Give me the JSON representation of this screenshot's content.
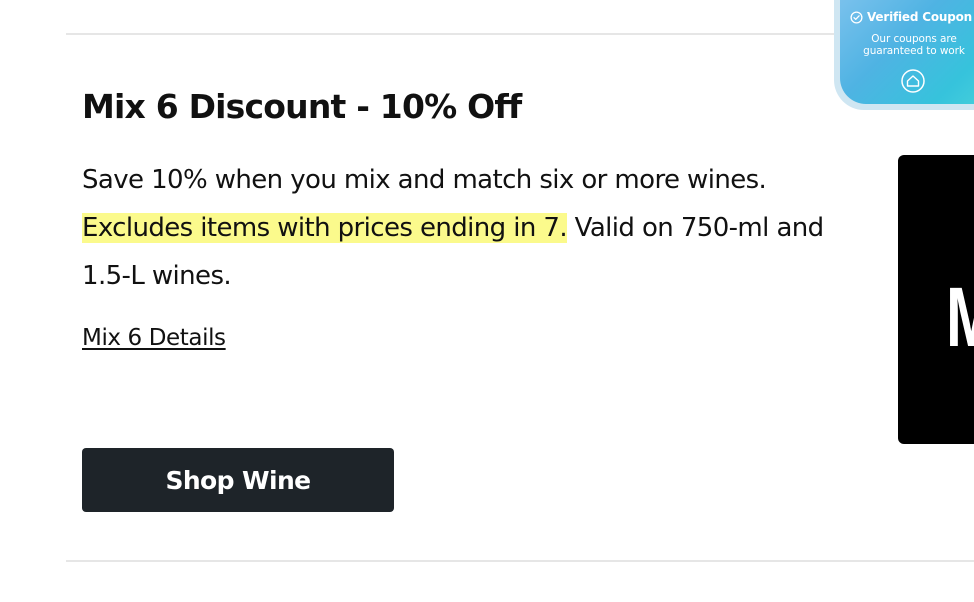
{
  "offer": {
    "title": "Mix 6 Discount - 10% Off",
    "description_plain_1": "Save 10% when you mix and match six or more wines. ",
    "description_highlight": "Excludes items with prices ending in 7.",
    "description_plain_2": " Valid on 750-ml and 1.5-L wines.",
    "details_link": "Mix 6 Details",
    "shop_button": "Shop Wine"
  },
  "promo_image": {
    "visible_text": "M"
  },
  "coupon_badge": {
    "title": "Verified Coupon",
    "subtitle": "Our coupons are guaranteed to work",
    "icon": "check-circle-icon",
    "footer_icon": "house-badge-icon"
  },
  "colors": {
    "highlight": "#fbfa8c",
    "button_bg": "#1e2429",
    "divider": "#e6e6e6"
  }
}
